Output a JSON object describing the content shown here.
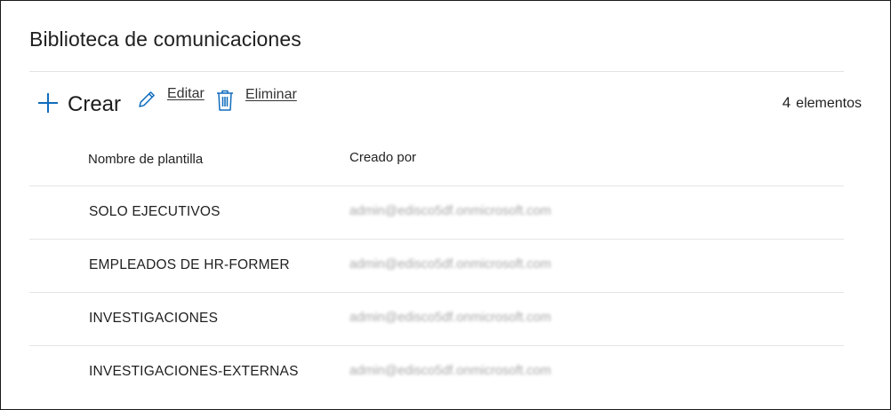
{
  "page": {
    "title": "Biblioteca de comunicaciones"
  },
  "toolbar": {
    "create_label": "Crear",
    "edit_label": "Editar",
    "delete_label": "Eliminar",
    "count_number": "4",
    "count_label": "elementos"
  },
  "table": {
    "columns": [
      "Nombre de plantilla",
      "Creado por"
    ],
    "rows": [
      {
        "name": "SOLO EJECUTIVOS",
        "created_by": "admin@edisco5df.onmicrosoft.com"
      },
      {
        "name": "EMPLEADOS DE HR-FORMER",
        "created_by": "admin@edisco5df.onmicrosoft.com"
      },
      {
        "name": "INVESTIGACIONES",
        "created_by": "admin@edisco5df.onmicrosoft.com"
      },
      {
        "name": "INVESTIGACIONES-EXTERNAS",
        "created_by": "admin@edisco5df.onmicrosoft.com"
      }
    ]
  },
  "icons": {
    "create": "plus-icon",
    "edit": "pencil-icon",
    "delete": "trash-icon"
  },
  "colors": {
    "accent": "#0f6cbd",
    "divider": "#e3e3e3"
  }
}
